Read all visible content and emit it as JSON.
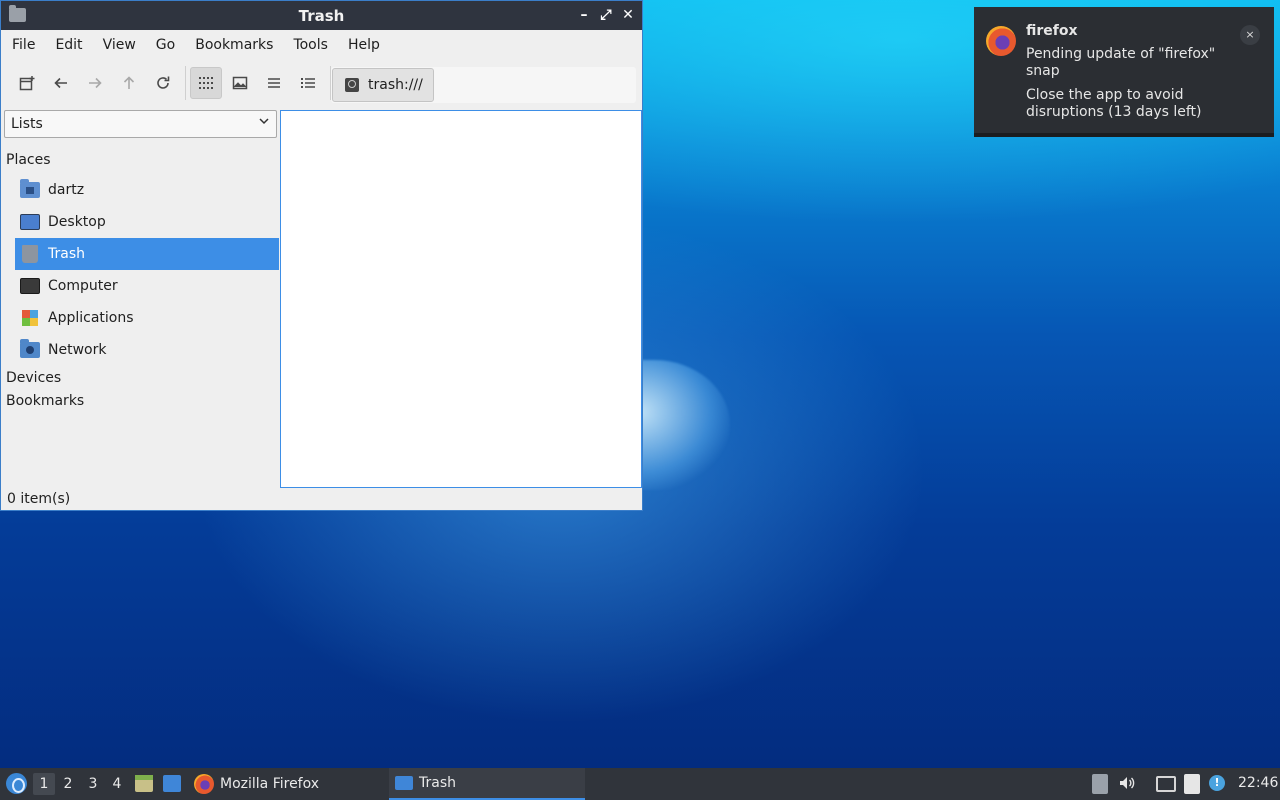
{
  "window": {
    "title": "Trash",
    "controls": {
      "minimize": "✕",
      "maximize": "⤢",
      "close": "✕"
    }
  },
  "menubar": [
    "File",
    "Edit",
    "View",
    "Go",
    "Bookmarks",
    "Tools",
    "Help"
  ],
  "toolbar": {
    "icons": [
      "new-tab-icon",
      "back-icon",
      "forward-icon",
      "up-icon",
      "reload-icon",
      "icon-view-icon",
      "thumbnail-view-icon",
      "compact-view-icon",
      "detailed-list-icon"
    ],
    "location": "trash:///"
  },
  "sidebar": {
    "mode": "Lists",
    "sections": {
      "places": "Places",
      "devices": "Devices",
      "bookmarks": "Bookmarks"
    },
    "places": [
      {
        "label": "dartz",
        "icon": "home-folder-icon"
      },
      {
        "label": "Desktop",
        "icon": "desktop-icon"
      },
      {
        "label": "Trash",
        "icon": "trash-icon",
        "selected": true
      },
      {
        "label": "Computer",
        "icon": "computer-icon"
      },
      {
        "label": "Applications",
        "icon": "applications-icon"
      },
      {
        "label": "Network",
        "icon": "network-icon"
      }
    ]
  },
  "statusbar": {
    "text": "0 item(s)"
  },
  "notification": {
    "app": "firefox",
    "line1": "Pending update of \"firefox\" snap",
    "line2": "Close the app to avoid disruptions (13 days left)",
    "close": "×"
  },
  "taskbar": {
    "workspaces": [
      "1",
      "2",
      "3",
      "4"
    ],
    "tasks": [
      {
        "label": "Mozilla Firefox",
        "icon": "firefox-icon"
      },
      {
        "label": "Trash",
        "icon": "folder-icon",
        "active": true
      }
    ],
    "clock": "22:46"
  },
  "colors": {
    "accent": "#3d8ee6",
    "titlebar": "#2f343f",
    "taskbar": "#30343b",
    "notification_bg": "#2b2e33"
  }
}
